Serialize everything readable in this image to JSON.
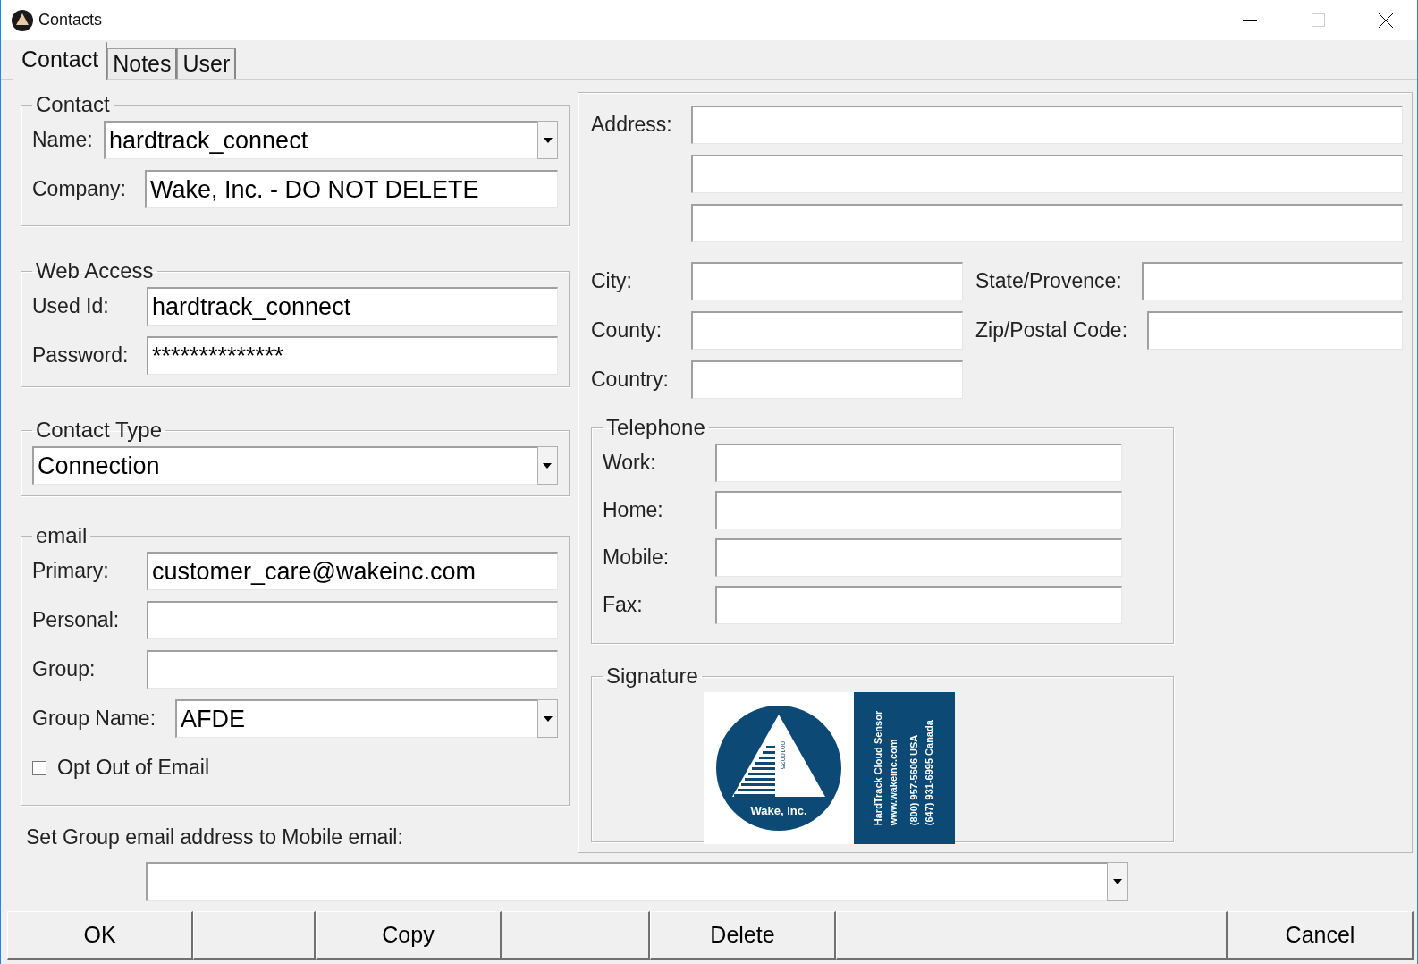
{
  "window": {
    "title": "Contacts"
  },
  "tabs": [
    {
      "label": "Contact",
      "selected": true
    },
    {
      "label": "Notes",
      "selected": false
    },
    {
      "label": "User",
      "selected": false
    }
  ],
  "contact": {
    "legend": "Contact",
    "name_label": "Name:",
    "name_value": "hardtrack_connect",
    "company_label": "Company:",
    "company_value": "Wake, Inc. - DO NOT DELETE"
  },
  "web_access": {
    "legend": "Web Access",
    "user_label": "Used Id:",
    "user_value": "hardtrack_connect",
    "password_label": "Password:",
    "password_value": "**************"
  },
  "contact_type": {
    "legend": "Contact Type",
    "value": "Connection"
  },
  "email": {
    "legend": "email",
    "fields": [
      {
        "label": "Primary:",
        "value": "customer_care@wakeinc.com"
      },
      {
        "label": "Personal:"
      },
      {
        "label": "Group:"
      }
    ],
    "group_name_label": "Group Name:",
    "group_name_value": "AFDE",
    "opt_out": {
      "label": "Opt Out of Email",
      "checked": false
    }
  },
  "group_email_label": "Set Group email address to Mobile email:",
  "address_label": "Address:",
  "location": {
    "city_label": "City:",
    "state_label": "State/Provence:",
    "county_label": "County:",
    "zip_label": "Zip/Postal Code:",
    "country_label": "Country:"
  },
  "telephone": {
    "legend": "Telephone",
    "fields": [
      {
        "label": "Work:"
      },
      {
        "label": "Home:"
      },
      {
        "label": "Mobile:"
      },
      {
        "label": "Fax:"
      }
    ]
  },
  "signature": {
    "legend": "Signature",
    "logo_text": "Wake, Inc.",
    "barcode_digits": "0010025",
    "card_lines": [
      "HardTrack Cloud Sensor",
      "www.wakeinc.com",
      "(800) 957-5606 USA",
      "(647) 931-6995 Canada"
    ]
  },
  "buttons": [
    {
      "label": "OK"
    },
    {
      "label": "Copy"
    },
    {
      "label": "Delete"
    },
    {
      "label": "Cancel"
    }
  ]
}
